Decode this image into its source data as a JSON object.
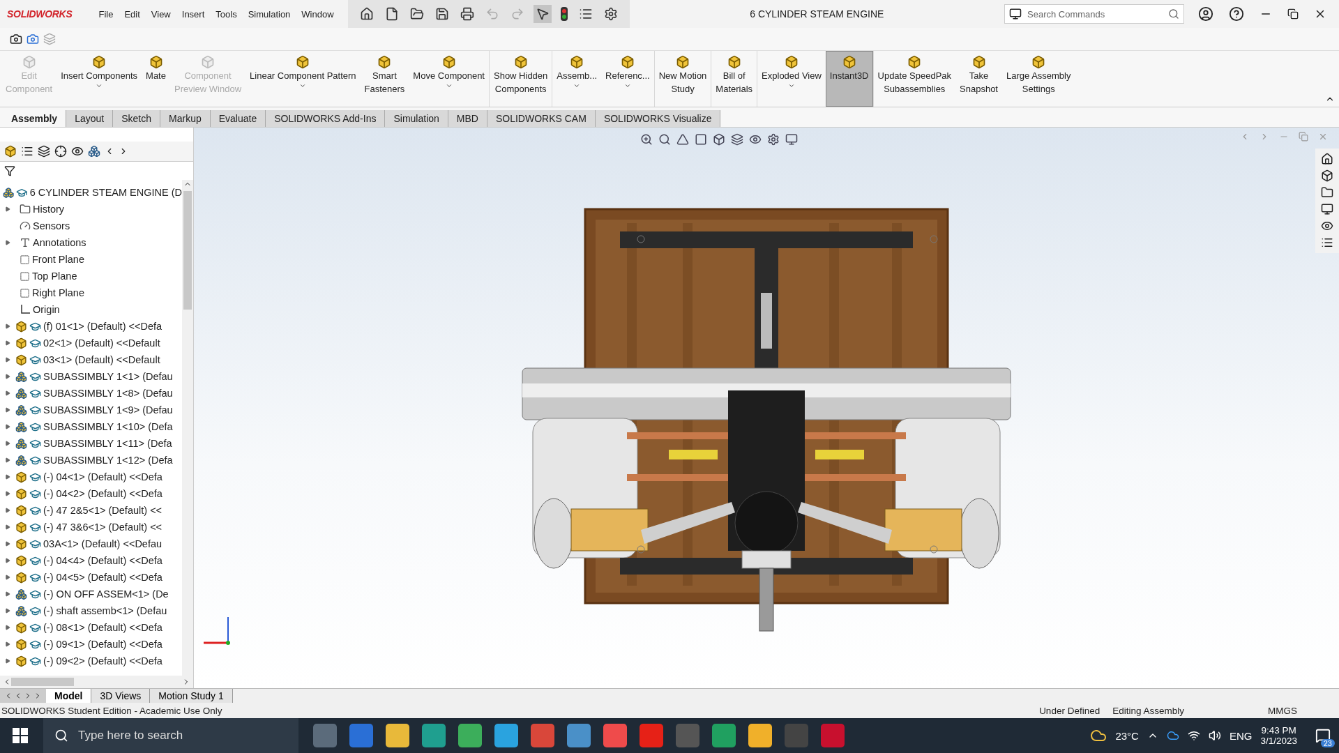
{
  "app": {
    "logo": "SOLIDWORKS",
    "title": "6 CYLINDER STEAM ENGINE",
    "search": {
      "placeholder": "Search Commands"
    }
  },
  "menu": [
    "File",
    "Edit",
    "View",
    "Insert",
    "Tools",
    "Simulation",
    "Window"
  ],
  "command_buttons": [
    {
      "lines": [
        "Edit",
        "Component"
      ],
      "disabled": true,
      "dropdown": false,
      "selected": false,
      "separator_before": false
    },
    {
      "lines": [
        "Insert Components"
      ],
      "disabled": false,
      "dropdown": true,
      "selected": false,
      "separator_before": false
    },
    {
      "lines": [
        "Mate"
      ],
      "disabled": false,
      "dropdown": false,
      "selected": false,
      "separator_before": false
    },
    {
      "lines": [
        "Component",
        "Preview Window"
      ],
      "disabled": true,
      "dropdown": false,
      "selected": false,
      "separator_before": false
    },
    {
      "lines": [
        "Linear Component Pattern"
      ],
      "disabled": false,
      "dropdown": true,
      "selected": false,
      "separator_before": false
    },
    {
      "lines": [
        "Smart",
        "Fasteners"
      ],
      "disabled": false,
      "dropdown": false,
      "selected": false,
      "separator_before": false
    },
    {
      "lines": [
        "Move Component"
      ],
      "disabled": false,
      "dropdown": true,
      "selected": false,
      "separator_before": false
    },
    {
      "lines": [
        "Show Hidden",
        "Components"
      ],
      "disabled": false,
      "dropdown": false,
      "selected": false,
      "separator_before": true
    },
    {
      "lines": [
        "Assemb..."
      ],
      "disabled": false,
      "dropdown": true,
      "selected": false,
      "separator_before": true
    },
    {
      "lines": [
        "Referenc..."
      ],
      "disabled": false,
      "dropdown": true,
      "selected": false,
      "separator_before": false
    },
    {
      "lines": [
        "New Motion",
        "Study"
      ],
      "disabled": false,
      "dropdown": false,
      "selected": false,
      "separator_before": true
    },
    {
      "lines": [
        "Bill of",
        "Materials"
      ],
      "disabled": false,
      "dropdown": false,
      "selected": false,
      "separator_before": true
    },
    {
      "lines": [
        "Exploded View"
      ],
      "disabled": false,
      "dropdown": true,
      "selected": false,
      "separator_before": true
    },
    {
      "lines": [
        "Instant3D"
      ],
      "disabled": false,
      "dropdown": false,
      "selected": true,
      "separator_before": false
    },
    {
      "lines": [
        "Update SpeedPak",
        "Subassemblies"
      ],
      "disabled": false,
      "dropdown": false,
      "selected": false,
      "separator_before": true
    },
    {
      "lines": [
        "Take",
        "Snapshot"
      ],
      "disabled": false,
      "dropdown": false,
      "selected": false,
      "separator_before": false
    },
    {
      "lines": [
        "Large Assembly",
        "Settings"
      ],
      "disabled": false,
      "dropdown": false,
      "selected": false,
      "separator_before": false
    }
  ],
  "ribbon_tabs": [
    {
      "label": "Assembly",
      "selected": true
    },
    {
      "label": "Layout",
      "selected": false
    },
    {
      "label": "Sketch",
      "selected": false
    },
    {
      "label": "Markup",
      "selected": false
    },
    {
      "label": "Evaluate",
      "selected": false
    },
    {
      "label": "SOLIDWORKS Add-Ins",
      "selected": false
    },
    {
      "label": "Simulation",
      "selected": false
    },
    {
      "label": "MBD",
      "selected": false
    },
    {
      "label": "SOLIDWORKS CAM",
      "selected": false
    },
    {
      "label": "SOLIDWORKS Visualize",
      "selected": false
    }
  ],
  "tree": {
    "root": "6 CYLINDER STEAM ENGINE (D",
    "items": [
      {
        "label": "History",
        "kind": "history",
        "has_children": true
      },
      {
        "label": "Sensors",
        "kind": "sensors",
        "has_children": false
      },
      {
        "label": "Annotations",
        "kind": "annotations",
        "has_children": true
      },
      {
        "label": "Front Plane",
        "kind": "plane",
        "has_children": false
      },
      {
        "label": "Top Plane",
        "kind": "plane",
        "has_children": false
      },
      {
        "label": "Right Plane",
        "kind": "plane",
        "has_children": false
      },
      {
        "label": "Origin",
        "kind": "origin",
        "has_children": false
      },
      {
        "label": "(f) 01<1> (Default) <<Defa",
        "kind": "part",
        "has_children": true
      },
      {
        "label": "02<1> (Default) <<Default",
        "kind": "part",
        "has_children": true
      },
      {
        "label": "03<1> (Default) <<Default",
        "kind": "part",
        "has_children": true
      },
      {
        "label": "SUBASSIMBLY 1<1> (Defau",
        "kind": "assembly",
        "has_children": true
      },
      {
        "label": "SUBASSIMBLY 1<8> (Defau",
        "kind": "assembly",
        "has_children": true
      },
      {
        "label": "SUBASSIMBLY 1<9> (Defau",
        "kind": "assembly",
        "has_children": true
      },
      {
        "label": "SUBASSIMBLY 1<10> (Defa",
        "kind": "assembly",
        "has_children": true
      },
      {
        "label": "SUBASSIMBLY 1<11> (Defa",
        "kind": "assembly",
        "has_children": true
      },
      {
        "label": "SUBASSIMBLY 1<12> (Defa",
        "kind": "assembly",
        "has_children": true
      },
      {
        "label": "(-) 04<1> (Default) <<Defa",
        "kind": "part",
        "has_children": true
      },
      {
        "label": "(-) 04<2> (Default) <<Defa",
        "kind": "part",
        "has_children": true
      },
      {
        "label": "(-) 47 2&5<1> (Default) <<",
        "kind": "part",
        "has_children": true
      },
      {
        "label": "(-) 47 3&6<1> (Default) <<",
        "kind": "part",
        "has_children": true
      },
      {
        "label": "03A<1> (Default) <<Defau",
        "kind": "part",
        "has_children": true
      },
      {
        "label": "(-) 04<4> (Default) <<Defa",
        "kind": "part",
        "has_children": true
      },
      {
        "label": "(-) 04<5> (Default) <<Defa",
        "kind": "part",
        "has_children": true
      },
      {
        "label": "(-) ON OFF ASSEM<1> (De",
        "kind": "assembly",
        "has_children": true
      },
      {
        "label": "(-) shaft assemb<1> (Defau",
        "kind": "assembly",
        "has_children": true
      },
      {
        "label": "(-) 08<1> (Default) <<Defa",
        "kind": "part",
        "has_children": true
      },
      {
        "label": "(-) 09<1> (Default) <<Defa",
        "kind": "part",
        "has_children": true
      },
      {
        "label": "(-) 09<2> (Default) <<Defa",
        "kind": "part",
        "has_children": true
      }
    ]
  },
  "bottom_tabs": [
    {
      "label": "Model",
      "selected": true
    },
    {
      "label": "3D Views",
      "selected": false
    },
    {
      "label": "Motion Study 1",
      "selected": false
    }
  ],
  "status_bar": {
    "edition": "SOLIDWORKS Student Edition - Academic Use Only",
    "state": "Under Defined",
    "mode": "Editing Assembly",
    "units": "MMGS"
  },
  "taskbar": {
    "search_placeholder": "Type here to search",
    "weather": "23°C",
    "language": "ENG",
    "time": "9:43 PM",
    "date": "3/1/2023",
    "notifications": "23"
  }
}
